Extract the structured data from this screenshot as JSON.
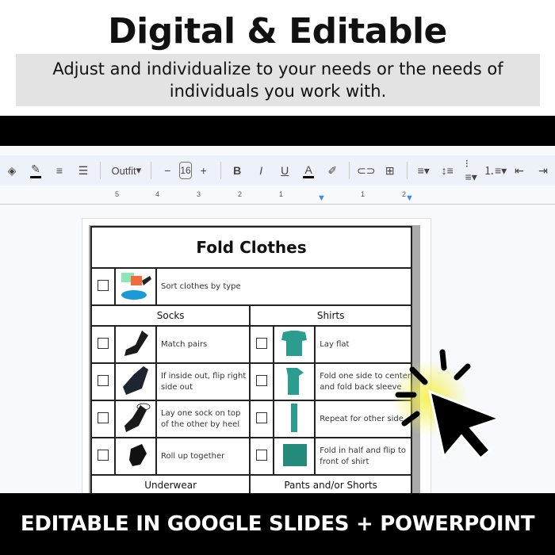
{
  "header": {
    "headline": "Digital & Editable",
    "subtitle": "Adjust and individualize to your needs or the needs of individuals you work with."
  },
  "toolbar": {
    "font": "Outfit",
    "font_size": "16",
    "bold": "B",
    "italic": "I",
    "underline": "U",
    "text_color": "A",
    "minus": "−",
    "plus": "+"
  },
  "ruler": {
    "labels": [
      "5",
      "4",
      "3",
      "2",
      "1",
      "1",
      "2"
    ]
  },
  "doc": {
    "title": "Fold Clothes",
    "sort_step": "Sort clothes by type",
    "sections": [
      "Socks",
      "Shirts",
      "Underwear",
      "Pants and/or Shorts"
    ],
    "socks": [
      "Match pairs",
      "If inside out, flip right side out",
      "Lay one sock on top of the other by heel",
      "Roll up together"
    ],
    "shirts": [
      "Lay flat",
      "Fold one side to center and fold back sleeve",
      "Repeat for other side",
      "Fold in half and flip to front of shirt"
    ]
  },
  "footer": {
    "banner": "EDITABLE IN GOOGLE SLIDES + POWERPOINT"
  },
  "colors": {
    "toolbar_bg": "#edf2fa",
    "shirt": "#2a9d8f",
    "sock": "#1a1a1a",
    "glow": "#f5f04a",
    "ruler_marker": "#4285f4"
  }
}
